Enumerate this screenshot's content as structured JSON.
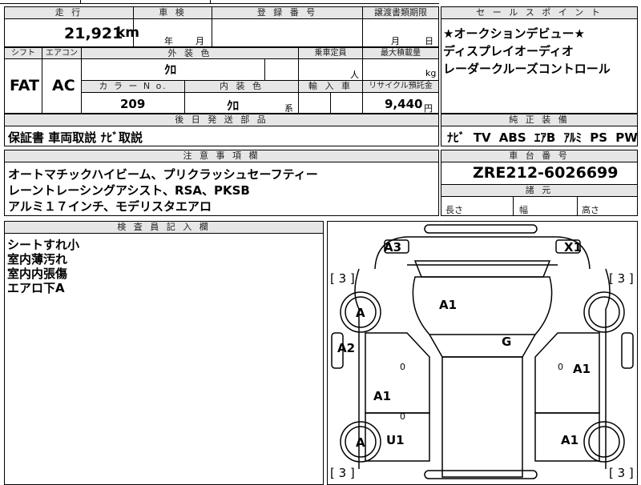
{
  "top_row": {
    "header_mileage": "走 行",
    "header_inspection": "車 検",
    "header_registration": "登 録 番 号",
    "header_transfer": "譲渡書類期限",
    "mileage_value": "21,921",
    "mileage_unit": "km",
    "inspection_year": "年",
    "inspection_month": "月",
    "transfer_month": "月",
    "transfer_day": "日"
  },
  "spec_row": {
    "header_shift": "シフト",
    "header_ac": "エアコン",
    "header_exterior_color": "外 装 色",
    "header_capacity": "乗車定員",
    "header_max_load": "最大積載量",
    "shift_value": "FAT",
    "ac_value": "AC",
    "exterior_color_value": "ｸﾛ",
    "capacity_unit": "人",
    "load_unit": "kg",
    "header_color_no": "カ ラ ー N o.",
    "header_interior_color": "内 装 色",
    "header_import": "輸 入 車",
    "header_recycle": "リサイクル預託金",
    "color_no_value": "209",
    "interior_color_value": "ｸﾛ",
    "interior_color_suffix": "系",
    "recycle_value": "9,440",
    "recycle_unit": "円"
  },
  "after_parts": {
    "header": "後 日 発 送 部 品",
    "value": "保証書 車両取説 ﾅﾋﾞ取説"
  },
  "sales_points": {
    "header": "セ ー ル ス ポ イ ン ト",
    "lines": [
      "★オークションデビュー★",
      "ディスプレイオーディオ",
      "レーダークルーズコントロール"
    ]
  },
  "genuine_equipment": {
    "header": "純 正 装 備",
    "value": "ﾅﾋﾞ TV ABS ｴｱB ｱﾙﾐ PS PW"
  },
  "notes": {
    "header": "注 意 事 項 欄",
    "lines": [
      "オートマチックハイビーム、プリクラッシュセーフティー",
      "レーントレーシングアシスト、RSA、PKSB",
      "アルミ１７インチ、モデリスタエアロ"
    ]
  },
  "chassis": {
    "header": "車 台 番 号",
    "value": "ZRE212-6026699",
    "dims_header": "諸 元",
    "length_label": "長さ",
    "width_label": "幅",
    "height_label": "高さ"
  },
  "inspector": {
    "header": "検 査 員 記 入 欄",
    "lines": [
      "シートすれ小",
      "室内薄汚れ",
      "室内内張傷",
      "エアロ下A"
    ]
  },
  "diagram": {
    "labels": {
      "front_left_panel": "A3",
      "front_right_panel": "X1",
      "hood": "A1",
      "roof": "G",
      "left_front_door": "A2",
      "right_front_door": "A1",
      "left_rear_door": "A1",
      "left_rear_fender": "U1",
      "right_rear_fender": "A1",
      "front_left_wheel": "A",
      "rear_left_wheel": "A"
    },
    "tire_marks": [
      "[ 3 ]",
      "[ 3 ]",
      "[ 3 ]",
      "[ 3 ]"
    ],
    "zero_marks": [
      "0",
      "0",
      "0"
    ]
  }
}
